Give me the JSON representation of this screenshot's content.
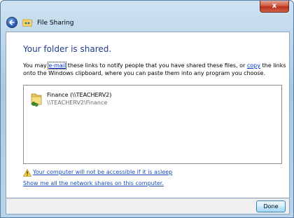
{
  "window": {
    "title": "File Sharing",
    "close_glyph": "x"
  },
  "main": {
    "heading": "Your folder is shared.",
    "desc_part1": "You may ",
    "email_link": "e-mail",
    "desc_part2": " these links to notify people that you have shared these files, or ",
    "copy_link": "copy",
    "desc_part3": " the links onto the Windows clipboard, where you can paste them into any program you choose."
  },
  "shares": [
    {
      "name": "Finance (\\\\TEACHERV2)",
      "path": "\\\\TEACHERV2\\Finance",
      "icon": "shared-folder-icon"
    }
  ],
  "links": {
    "warning": "Your computer will not be accessible if it is asleep",
    "show_shares": "Show me all the network shares on this computer."
  },
  "footer": {
    "done_label": "Done"
  },
  "colors": {
    "heading": "#1f3b8a",
    "link": "#1a4fb4"
  }
}
